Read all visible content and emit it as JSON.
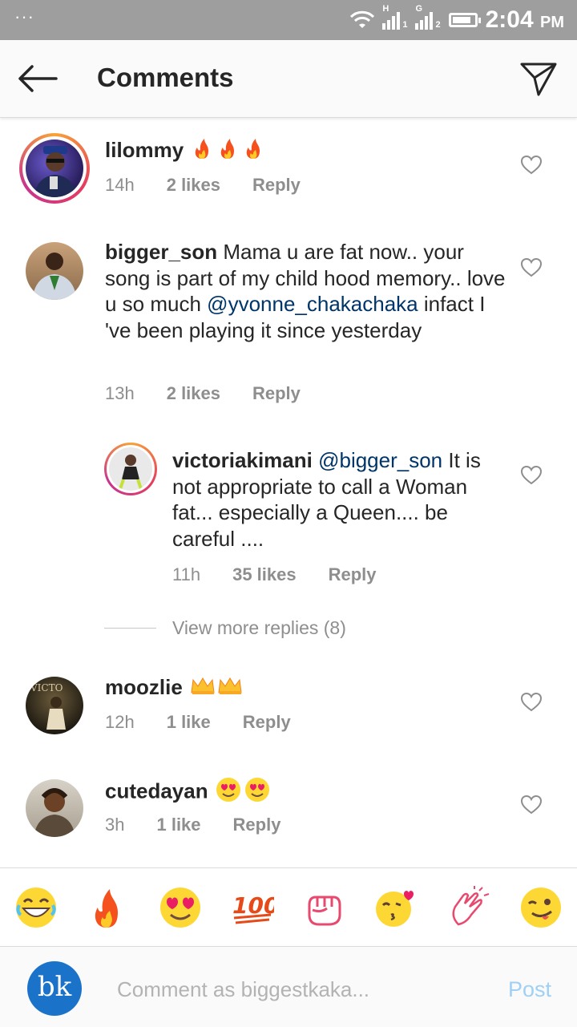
{
  "status_bar": {
    "dots": "···",
    "time": "2:04",
    "ampm": "PM",
    "signal1_label": "H",
    "signal1_sub": "1",
    "signal2_label": "G",
    "signal2_sub": "2"
  },
  "header": {
    "title": "Comments"
  },
  "comments": [
    {
      "username": "lilommy",
      "text": "",
      "time": "14h",
      "likes": "2 likes",
      "reply": "Reply"
    },
    {
      "username": "bigger_son",
      "text": " Mama u are fat now.. your song is part of my child hood memory.. love u so much ",
      "mention": "@yvonne_chakachaka",
      "text2": " infact I 've been playing it since yesterday",
      "time": "13h",
      "likes": "2 likes",
      "reply": "Reply"
    },
    {
      "username": "victoriakimani",
      "mention": "@bigger_son",
      "text": " It is not appropriate to call a Woman fat... especially a Queen.... be careful ....",
      "time": "11h",
      "likes": "35 likes",
      "reply": "Reply"
    },
    {
      "username": "moozlie",
      "text": "",
      "time": "12h",
      "likes": "1 like",
      "reply": "Reply"
    },
    {
      "username": "cutedayan",
      "text": "",
      "time": "3h",
      "likes": "1 like",
      "reply": "Reply"
    }
  ],
  "view_more_replies": "View more replies (8)",
  "emoji_bar": [
    "joy-emoji",
    "fire-emoji",
    "heart-eyes-emoji",
    "hundred-emoji",
    "fist-emoji",
    "kiss-emoji",
    "clap-emoji",
    "wink-tongue-emoji"
  ],
  "compose": {
    "avatar_initials": "bk",
    "placeholder": "Comment as biggestkaka...",
    "post_label": "Post"
  },
  "colors": {
    "link": "#003569",
    "muted": "#8e8e8e",
    "post": "#9fd0f5",
    "status_bar": "#9e9e9e"
  }
}
